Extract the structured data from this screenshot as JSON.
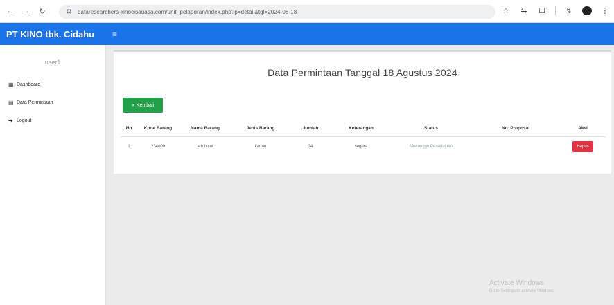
{
  "browser": {
    "url": "dataresearchers-kinocisauasa.com/unit_pelaporan/index.php?p=detail&tgl=2024-08-18",
    "icons": [
      "back-icon",
      "forward-icon",
      "reload-icon",
      "site-info-icon",
      "star-icon",
      "cast-icon",
      "extension-icon",
      "profile-icon"
    ]
  },
  "header": {
    "brand": "PT KINO tbk. Cidahu",
    "menu_icon": "≡",
    "color": "#1a73e8"
  },
  "sidebar": {
    "user": "user1",
    "items": [
      {
        "icon": "dashboard-icon",
        "label": "Dashboard"
      },
      {
        "icon": "document-icon",
        "label": "Data Permintaan"
      },
      {
        "icon": "logout-icon",
        "label": "Logout"
      }
    ]
  },
  "main": {
    "title": "Data Permintaan Tanggal 18 Agustus 2024",
    "back_button": "Kembali",
    "table": {
      "headers": [
        "No",
        "Kode Barang",
        "Nama Barang",
        "Jenis Barang",
        "Jumlah",
        "Keterangan",
        "Status",
        "No. Proposal",
        "Aksi"
      ],
      "rows": [
        {
          "no": "1",
          "kode_barang": "234000",
          "nama_barang": "teh botol",
          "jenis_barang": "karton",
          "jumlah": "24",
          "keterangan": "segera",
          "status": "Menunggu Persetujuan",
          "no_proposal": "",
          "action": "Hapus"
        }
      ]
    }
  },
  "watermark": {
    "line1": "Activate Windows",
    "line2": "Go to Settings to activate Windows."
  },
  "colors": {
    "primary": "#1a73e8",
    "success": "#22a04a",
    "danger": "#dc3545"
  }
}
